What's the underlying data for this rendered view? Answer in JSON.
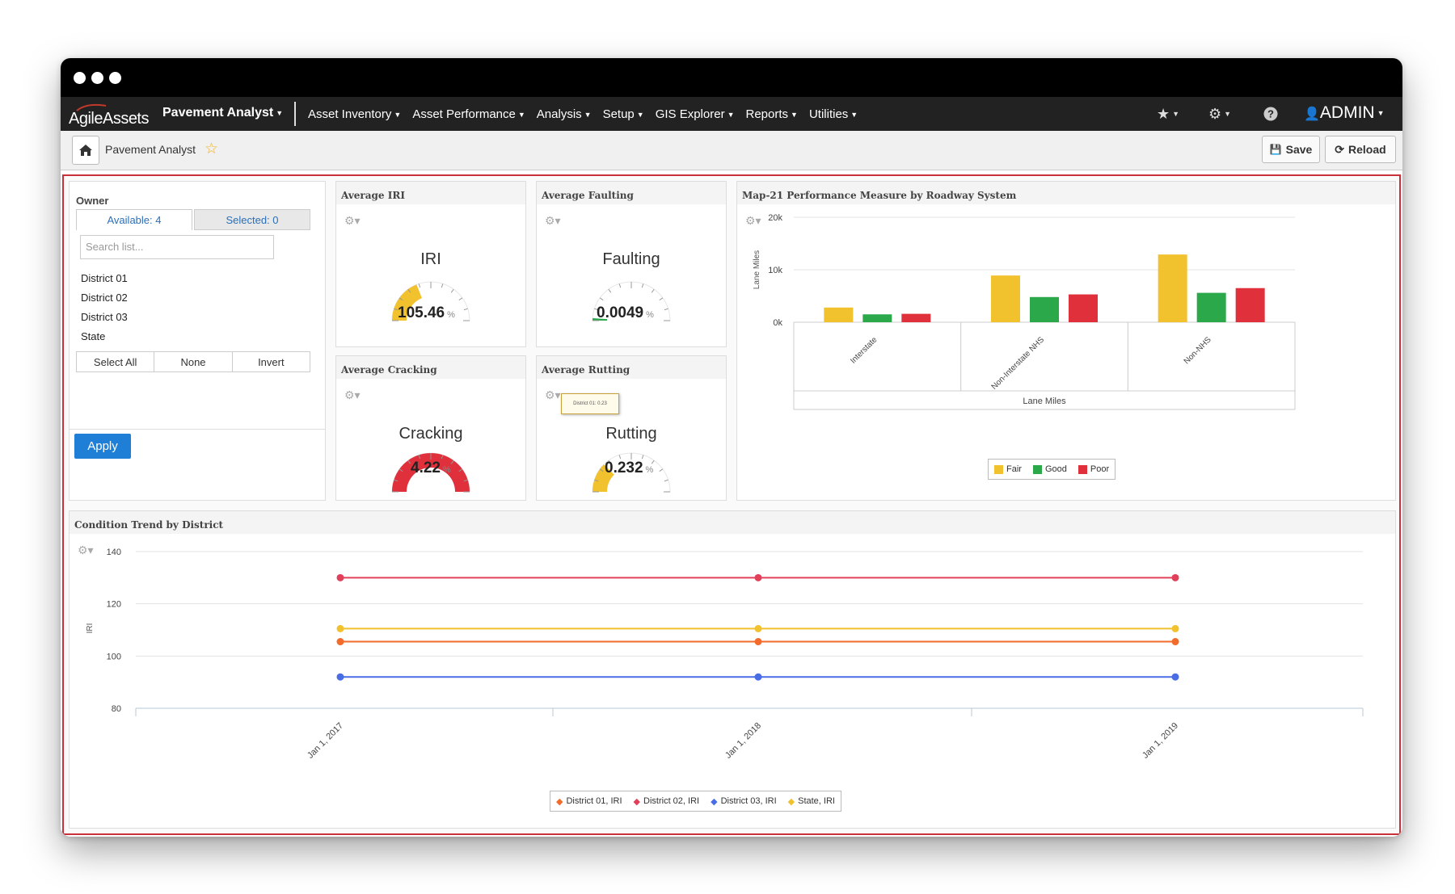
{
  "app": {
    "logo_text": "AgileAssets",
    "module": "Pavement Analyst",
    "menu": [
      "Asset Inventory",
      "Asset Performance",
      "Analysis",
      "Setup",
      "GIS Explorer",
      "Reports",
      "Utilities"
    ],
    "user": "ADMIN"
  },
  "toolbar": {
    "breadcrumb": "Pavement Analyst",
    "save_label": "Save",
    "reload_label": "Reload"
  },
  "owner": {
    "title": "Owner",
    "available_tab": "Available: 4",
    "selected_tab": "Selected: 0",
    "search_placeholder": "Search list...",
    "items": [
      "District 01",
      "District 02",
      "District 03",
      "State"
    ],
    "select_all": "Select All",
    "none": "None",
    "invert": "Invert",
    "apply": "Apply"
  },
  "gauges": {
    "iri": {
      "header": "Average IRI",
      "title": "IRI",
      "value": "105.46",
      "unit": "%",
      "fill": 0.38,
      "color": "#f2c12e"
    },
    "faulting": {
      "header": "Average Faulting",
      "title": "Faulting",
      "value": "0.0049",
      "unit": "%",
      "fill": 0.02,
      "color": "#2aa84a"
    },
    "cracking": {
      "header": "Average Cracking",
      "title": "Cracking",
      "value": "4.22",
      "unit": "%",
      "fill": 1.0,
      "color": "#e0303c"
    },
    "rutting": {
      "header": "Average Rutting",
      "title": "Rutting",
      "value": "0.232",
      "unit": "%",
      "fill": 0.25,
      "color": "#f2c12e",
      "tooltip": "District 01: 0.23"
    }
  },
  "chart_data": [
    {
      "type": "bar",
      "title": "Map-21 Performance Measure by Roadway System",
      "ylabel": "Lane Miles",
      "xlabel": "Lane Miles",
      "categories": [
        "Interstate",
        "Non-Interstate NHS",
        "Non-NHS"
      ],
      "ylim": [
        0,
        20000
      ],
      "yticks": [
        "0k",
        "10k",
        "20k"
      ],
      "series": [
        {
          "name": "Fair",
          "color": "#f2c12e",
          "values": [
            2800,
            8900,
            12900
          ]
        },
        {
          "name": "Good",
          "color": "#2aa84a",
          "values": [
            1500,
            4800,
            5600
          ]
        },
        {
          "name": "Poor",
          "color": "#e0303c",
          "values": [
            1600,
            5300,
            6500
          ]
        }
      ],
      "legend": "bottom"
    },
    {
      "type": "line",
      "title": "Condition Trend by District",
      "ylabel": "IRI",
      "x": [
        "Jan 1, 2017",
        "Jan 1, 2018",
        "Jan 1, 2019"
      ],
      "ylim": [
        80,
        140
      ],
      "yticks": [
        80,
        100,
        120,
        140
      ],
      "series": [
        {
          "name": "District 01, IRI",
          "color": "#f26b2a",
          "values": [
            105.5,
            105.5,
            105.5
          ]
        },
        {
          "name": "District 02, IRI",
          "color": "#e0405a",
          "values": [
            130,
            130,
            130
          ]
        },
        {
          "name": "District 03, IRI",
          "color": "#4a6de5",
          "values": [
            92,
            92,
            92
          ]
        },
        {
          "name": "State, IRI",
          "color": "#f2c12e",
          "values": [
            110.5,
            110.5,
            110.5
          ]
        }
      ],
      "legend": "bottom"
    }
  ]
}
